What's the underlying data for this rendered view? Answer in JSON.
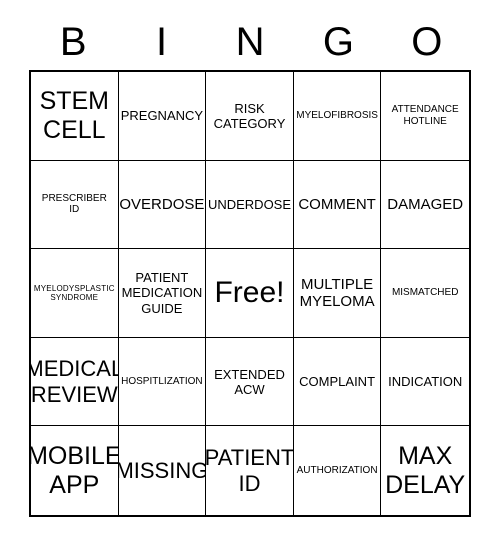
{
  "card": {
    "title": "BINGO",
    "header_letters": [
      "B",
      "I",
      "N",
      "G",
      "O"
    ],
    "grid_size": "5x5",
    "colors": {
      "background": "#ffffff",
      "text": "#000000",
      "border": "#000000"
    }
  },
  "cells": [
    {
      "text": "STEM\nCELL",
      "size": "t-xxl",
      "free": false
    },
    {
      "text": "PREGNANCY",
      "size": "t-md",
      "free": false
    },
    {
      "text": "RISK\nCATEGORY",
      "size": "t-md",
      "free": false
    },
    {
      "text": "MYELOFIBROSIS",
      "size": "t-sm",
      "free": false
    },
    {
      "text": "ATTENDANCE\nHOTLINE",
      "size": "t-sm",
      "free": false
    },
    {
      "text": "PRESCRIBER\nID",
      "size": "t-sm",
      "free": false
    },
    {
      "text": "OVERDOSE",
      "size": "t-lg",
      "free": false
    },
    {
      "text": "UNDERDOSE",
      "size": "t-md",
      "free": false
    },
    {
      "text": "COMMENT",
      "size": "t-lg",
      "free": false
    },
    {
      "text": "DAMAGED",
      "size": "t-lg",
      "free": false
    },
    {
      "text": "MYELODYSPLASTIC\nSYNDROME",
      "size": "t-xs",
      "free": false
    },
    {
      "text": "PATIENT\nMEDICATION\nGUIDE",
      "size": "t-md",
      "free": false
    },
    {
      "text": "Free!",
      "size": "t-free",
      "free": true
    },
    {
      "text": "MULTIPLE\nMYELOMA",
      "size": "t-lg",
      "free": false
    },
    {
      "text": "MISMATCHED",
      "size": "t-sm",
      "free": false
    },
    {
      "text": "MEDICAL\nREVIEW",
      "size": "t-xl",
      "free": false
    },
    {
      "text": "HOSPITLIZATION",
      "size": "t-sm",
      "free": false
    },
    {
      "text": "EXTENDED\nACW",
      "size": "t-md",
      "free": false
    },
    {
      "text": "COMPLAINT",
      "size": "t-md",
      "free": false
    },
    {
      "text": "INDICATION",
      "size": "t-md",
      "free": false
    },
    {
      "text": "MOBILE\nAPP",
      "size": "t-xxl",
      "free": false
    },
    {
      "text": "MISSING",
      "size": "t-xl",
      "free": false
    },
    {
      "text": "PATIENT\nID",
      "size": "t-xl",
      "free": false
    },
    {
      "text": "AUTHORIZATION",
      "size": "t-sm",
      "free": false
    },
    {
      "text": "MAX\nDELAY",
      "size": "t-xxl",
      "free": false
    }
  ]
}
